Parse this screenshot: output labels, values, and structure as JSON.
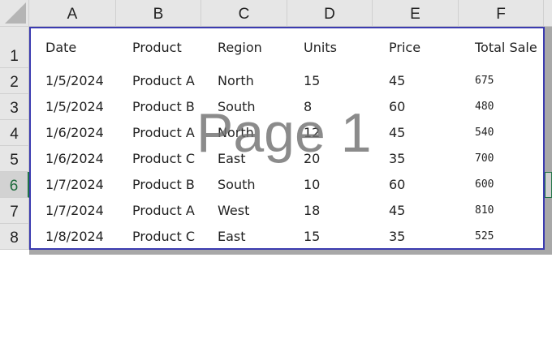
{
  "columns": [
    "A",
    "B",
    "C",
    "D",
    "E",
    "F"
  ],
  "rows": [
    "1",
    "2",
    "3",
    "4",
    "5",
    "6",
    "7",
    "8"
  ],
  "selected_row": "6",
  "watermark": "Page 1",
  "table": {
    "headers": [
      "Date",
      "Product",
      "Region",
      "Units",
      "Price",
      "Total Sale"
    ],
    "data": [
      [
        "1/5/2024",
        "Product A",
        "North",
        "15",
        "45",
        "675"
      ],
      [
        "1/5/2024",
        "Product B",
        "South",
        "8",
        "60",
        "480"
      ],
      [
        "1/6/2024",
        "Product A",
        "North",
        "12",
        "45",
        "540"
      ],
      [
        "1/6/2024",
        "Product C",
        "East",
        "20",
        "35",
        "700"
      ],
      [
        "1/7/2024",
        "Product B",
        "South",
        "10",
        "60",
        "600"
      ],
      [
        "1/7/2024",
        "Product A",
        "West",
        "18",
        "45",
        "810"
      ],
      [
        "1/8/2024",
        "Product C",
        "East",
        "15",
        "35",
        "525"
      ]
    ]
  }
}
